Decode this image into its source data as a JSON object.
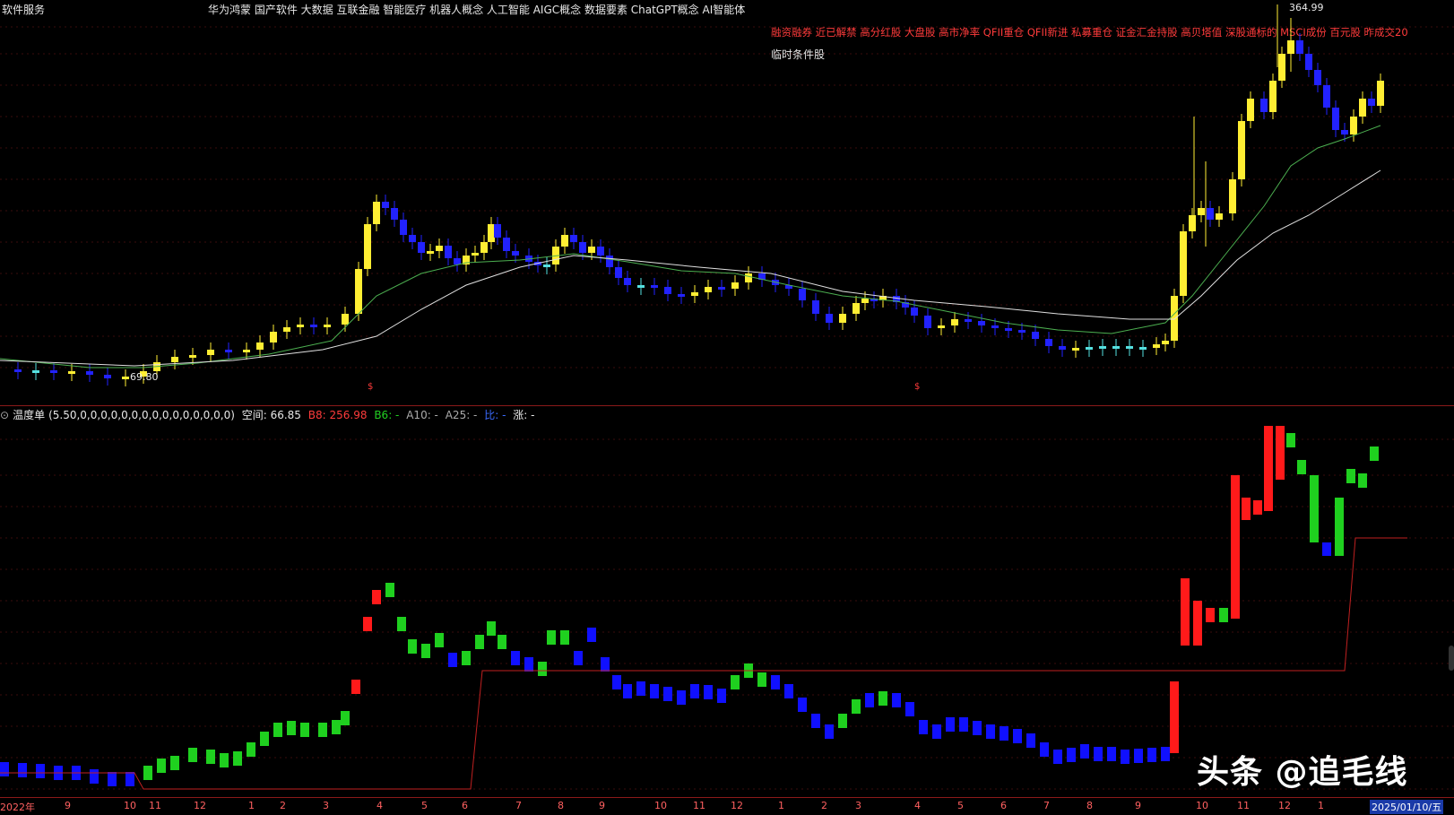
{
  "header": {
    "left_title": "软件服务",
    "concepts": "华为鸿蒙 国产软件 大数据 互联金融 智能医疗 机器人概念 人工智能 AIGC概念 数据要素 ChatGPT概念 AI智能体",
    "tags": "融资融券 近已解禁 高分红股 大盘股 高市净率 QFII重仓 QFII新进 私募重仓 证金汇金持股 高贝塔值 深股通标的 MSCI成份 百元股 昨成交20",
    "condition": "临时条件股"
  },
  "price_labels": {
    "high": "364.99",
    "low": "69.80"
  },
  "markers": [
    "$",
    "$"
  ],
  "indicator": {
    "name": "温度单",
    "params": "(5.50,0,0,0,0,0,0,0,0,0,0,0,0,0,0,0)",
    "space_label": "空间: 66.85",
    "b8": "B8: 256.98",
    "b6": "B6: -",
    "a10": "A10: -",
    "a25": "A25: -",
    "bi": "比: -",
    "zhang": "涨: -"
  },
  "time_axis": [
    "2022年",
    "9",
    "10",
    "11",
    "12",
    "1",
    "2",
    "3",
    "4",
    "5",
    "6",
    "7",
    "8",
    "9",
    "10",
    "11",
    "12",
    "1",
    "2",
    "3",
    "4",
    "5",
    "6",
    "7",
    "8",
    "9",
    "10",
    "11",
    "12",
    "1"
  ],
  "time_axis_date": "2025/01/10/五",
  "watermark": "头条 @追毛线",
  "colors": {
    "up": "#ffee33",
    "down": "#2222ff",
    "flat": "#55e0e0",
    "ma": "#4caf50",
    "ma2": "#e0e0e0",
    "ind_red": "#ff1a1a",
    "ind_green": "#1fd01f",
    "ind_blue": "#1010ff",
    "step_line": "#c02020"
  }
}
